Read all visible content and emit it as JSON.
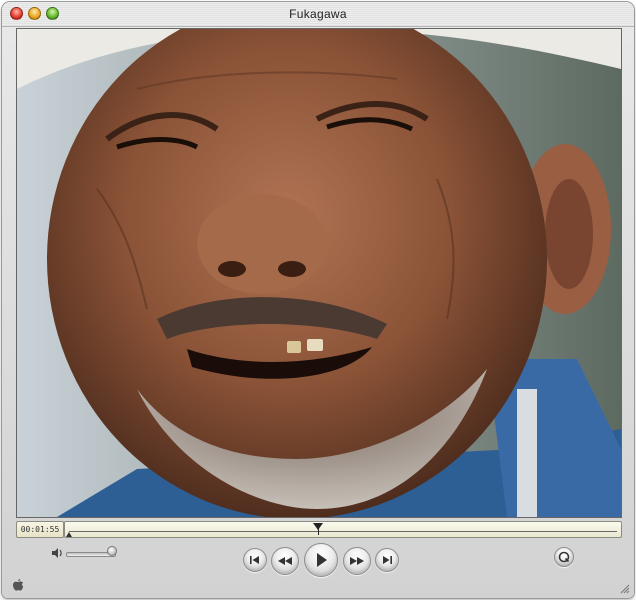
{
  "window": {
    "title": "Fukagawa"
  },
  "player": {
    "timecode": "00:01:55",
    "playhead_fraction": 0.455,
    "selection_start_fraction": 0.0,
    "volume_fraction": 0.92
  },
  "icons": {
    "close": "close-icon",
    "minimize": "minimize-icon",
    "zoom": "zoom-icon",
    "volume": "speaker-icon",
    "skip_start": "skip-to-start-icon",
    "rewind": "rewind-icon",
    "play": "play-icon",
    "fast_forward": "fast-forward-icon",
    "skip_end": "skip-to-end-icon",
    "quicktime": "quicktime-logo-icon",
    "apple": "apple-logo-icon",
    "resize": "resize-grip-icon"
  },
  "colors": {
    "window_chrome": "#d9d9d9",
    "timecode_bg": "#f0eed8",
    "close": "#e0392c",
    "minimize": "#e8a51c",
    "zoom": "#5fb52a"
  }
}
